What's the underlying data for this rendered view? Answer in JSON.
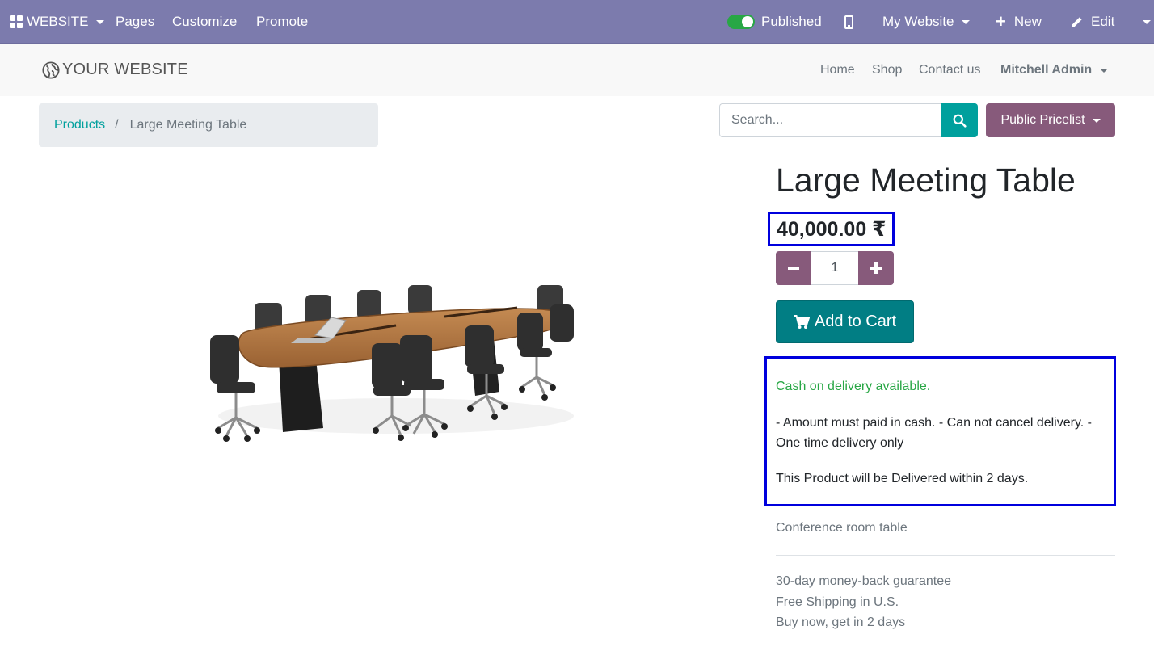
{
  "topbar": {
    "website_menu": "WEBSITE",
    "pages": "Pages",
    "customize": "Customize",
    "promote": "Promote",
    "published": "Published",
    "my_website": "My Website",
    "new": "New",
    "edit": "Edit"
  },
  "header": {
    "logo_text": "YOUR WEBSITE",
    "nav": {
      "home": "Home",
      "shop": "Shop",
      "contact": "Contact us"
    },
    "user": "Mitchell Admin"
  },
  "breadcrumb": {
    "parent": "Products",
    "separator": "/",
    "current": "Large Meeting Table"
  },
  "search": {
    "placeholder": "Search..."
  },
  "pricelist": {
    "label": "Public Pricelist"
  },
  "product": {
    "name": "Large Meeting Table",
    "price": "40,000.00 ₹",
    "quantity": "1",
    "add_to_cart": "Add to Cart",
    "cod": {
      "title": "Cash on delivery available.",
      "conditions": "- Amount must paid in cash. - Can not cancel delivery. - One time delivery only",
      "delivery": "This Product will be Delivered within 2 days."
    },
    "short_description": "Conference room table",
    "terms": [
      "30-day money-back guarantee",
      "Free Shipping in U.S.",
      "Buy now, get in 2 days"
    ]
  },
  "colors": {
    "topbar": "#7c7bad",
    "primary": "#875a7b",
    "teal": "#00a09d",
    "cart_button": "#017e84",
    "highlight_border": "#0000dd",
    "cod_green": "#28a745"
  }
}
